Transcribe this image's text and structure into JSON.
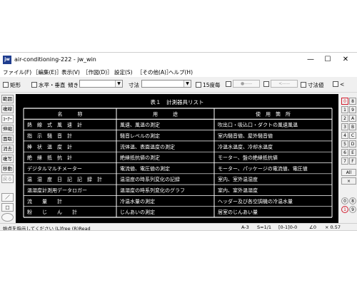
{
  "window": {
    "app_icon": "jw",
    "title": "air-conditioning-222 - jw_win",
    "minimize": "—",
    "maximize": "☐",
    "close": "✕"
  },
  "menu": [
    "ファイル(F)",
    "［編集(E)］",
    "表示(V)",
    "［作図(D)］",
    "設定(S)",
    "［その他(A)］",
    "ヘルプ(H)"
  ],
  "toolbar": {
    "rect": "矩形",
    "horiz_vert": "水平・垂直",
    "tilt": "傾き",
    "size": "寸法",
    "every15": "15度毎",
    "btn1": "●-----",
    "btn2": "<-----",
    "dim_value": "寸法値",
    "lt": "<"
  },
  "left_tools": [
    "範囲",
    "複線",
    "ｺｰﾅｰ",
    "伸縮",
    "面取",
    "消去",
    "複写",
    "移動",
    "戻る",
    "",
    "／",
    "□"
  ],
  "right_tools": [
    [
      "0",
      "8"
    ],
    [
      "1",
      "9"
    ],
    [
      "2",
      "A"
    ],
    [
      "3",
      "B"
    ],
    [
      "4",
      "C"
    ],
    [
      "5",
      "D"
    ],
    [
      "6",
      "E"
    ],
    [
      "7",
      "F"
    ],
    [
      "All",
      ""
    ],
    [
      "×",
      ""
    ],
    [
      "0",
      "8"
    ],
    [
      "1",
      "9"
    ]
  ],
  "canvas": {
    "table_title": "表１　計測器具リスト",
    "headers": [
      "名　　　称",
      "用　　　途",
      "使　用　箇　所"
    ],
    "rows": [
      [
        "熱　線　式　風　速　計",
        "風速、風温の測定",
        "吹出口・吸込口・ダクトの風速風温"
      ],
      [
        "指　示　騒　音　計",
        "騒音レベルの測定",
        "室内騒音値、屋外騒音値"
      ],
      [
        "棒　状　温　度　計",
        "流体温、表面温度の測定",
        "冷温水温度、冷却水温度"
      ],
      [
        "絶　縁　抵　抗　計",
        "絶縁抵抗値の測定",
        "モーター、盤の絶縁抵抗値"
      ],
      [
        "デジタルマルチメーター",
        "電流値、電圧値の測定",
        "モーター、パッケージの電流値、電圧値"
      ],
      [
        "温　湿　度　日　記　記　録　計",
        "温湿度の時系列変化の記録",
        "室内、室外温湿度"
      ],
      [
        "温湿度計測用データロガー",
        "温湿度の時系列変化のグラフ",
        "室内、室外温湿度"
      ],
      [
        "流　　量　　計",
        "冷温水量の測定",
        "ヘッダー及び各空調機の冷温水量"
      ],
      [
        "粉　　じ　　ん　　計",
        "じんあいの測定",
        "居室のじんあい量"
      ]
    ]
  },
  "status": {
    "message": "始点を指示してください (L)free (R)Read",
    "paper": "A-3",
    "scale": "S=1/1",
    "layer": "[0-1]0-0",
    "angle": "∠0",
    "zoom": "× 0.57"
  }
}
